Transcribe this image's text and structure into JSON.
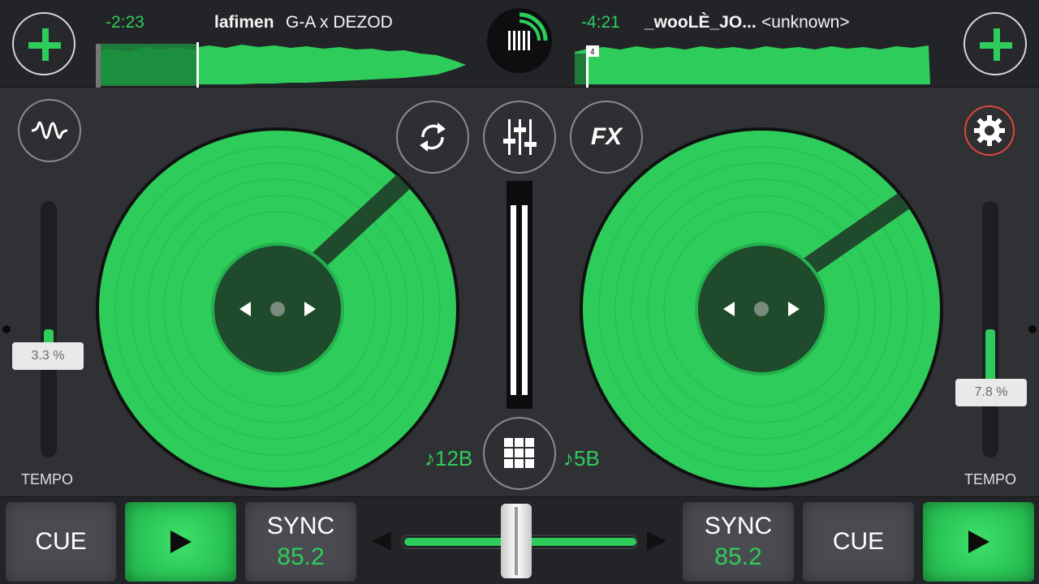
{
  "deck_a": {
    "time_remaining": "-2:23",
    "artist": "lafimen",
    "title": "G-A x DEZOD",
    "tempo_percent": "3.3 %",
    "tempo_label": "TEMPO",
    "key": "♪12B",
    "cue_label": "CUE",
    "sync_label": "SYNC",
    "bpm": "85.2"
  },
  "deck_b": {
    "time_remaining": "-4:21",
    "artist": "_wooLÈ_JO...",
    "title": "<unknown>",
    "cue_marker": "4",
    "tempo_percent": "7.8 %",
    "tempo_label": "TEMPO",
    "key": "♪5B",
    "cue_label": "CUE",
    "sync_label": "SYNC",
    "bpm": "85.2"
  },
  "mixer": {
    "fx_label": "FX",
    "crossfader_position": 0.5
  },
  "colors": {
    "accent": "#2ecc5a",
    "background": "#303135",
    "bar": "#232428",
    "settings_ring": "#e0463c"
  },
  "icons": [
    "add-track-icon",
    "waveform-view-icon",
    "loop-icon",
    "equalizer-icon",
    "settings-gear-icon",
    "sampler-grid-icon",
    "play-icon",
    "arrow-left-icon",
    "arrow-right-icon"
  ]
}
